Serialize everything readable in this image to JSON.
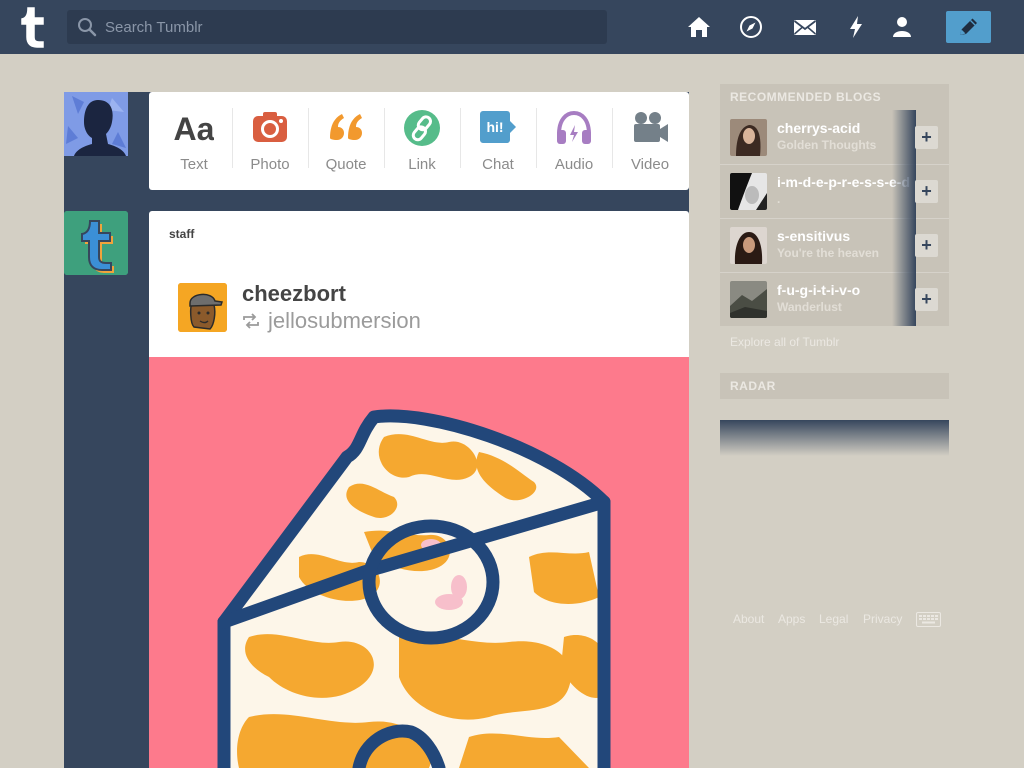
{
  "header": {
    "search_placeholder": "Search Tumblr",
    "nav": [
      "home-icon",
      "explore-icon",
      "messages-icon",
      "activity-icon",
      "account-icon"
    ],
    "compose_icon": "pencil-icon",
    "bg_color": "#36465d",
    "accent_color": "#529ecc"
  },
  "post_types": [
    {
      "label": "Text",
      "icon": "text-aa-icon",
      "color": "#444444"
    },
    {
      "label": "Photo",
      "icon": "camera-icon",
      "color": "#d95e40"
    },
    {
      "label": "Quote",
      "icon": "quote-icon",
      "color": "#f2992e"
    },
    {
      "label": "Link",
      "icon": "link-icon",
      "color": "#56bc8a"
    },
    {
      "label": "Chat",
      "icon": "chat-icon",
      "color": "#529ecc"
    },
    {
      "label": "Audio",
      "icon": "headphones-icon",
      "color": "#a77dc2"
    },
    {
      "label": "Video",
      "icon": "video-camera-icon",
      "color": "#748089"
    }
  ],
  "post": {
    "author": "staff",
    "reblogger": "cheezbort",
    "source": "jellosubmersion",
    "image_bg": "#fd7a8c"
  },
  "sidebar": {
    "recommended_title": "RECOMMENDED BLOGS",
    "blogs": [
      {
        "name": "cherrys-acid",
        "title": "Golden Thoughts"
      },
      {
        "name": "i-m-d-e-p-r-e-s-s-e-d",
        "title": "."
      },
      {
        "name": "s-ensitivus",
        "title": "You're the heaven"
      },
      {
        "name": "f-u-g-i-t-i-v-o",
        "title": "Wanderlust"
      }
    ],
    "follow_label": "+",
    "explore_link": "Explore all of Tumblr",
    "radar_title": "RADAR"
  },
  "footer": {
    "links": [
      "About",
      "Apps",
      "Legal",
      "Privacy"
    ]
  }
}
